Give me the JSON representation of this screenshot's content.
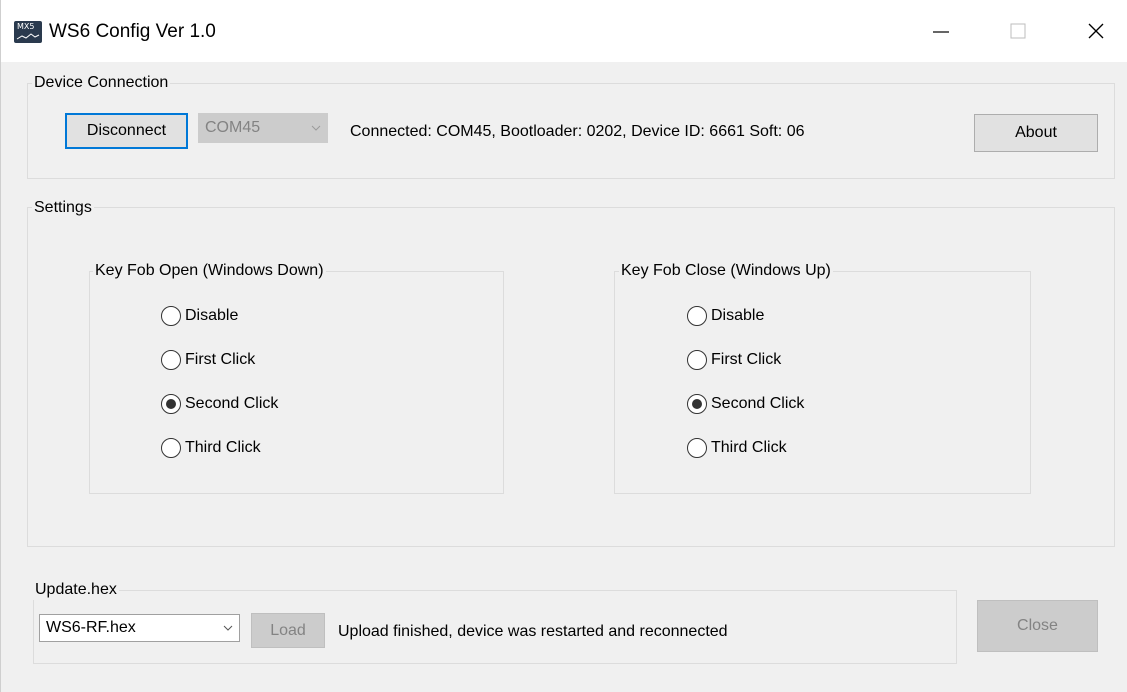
{
  "window": {
    "title": "WS6 Config Ver 1.0",
    "app_icon_text": "MX5"
  },
  "device_connection": {
    "label": "Device Connection",
    "disconnect_label": "Disconnect",
    "port_value": "COM45",
    "status": "Connected: COM45, Bootloader: 0202, Device ID: 6661 Soft: 06",
    "about_label": "About"
  },
  "settings": {
    "label": "Settings",
    "open_group": {
      "label": "Key Fob Open (Windows Down)",
      "options": [
        "Disable",
        "First Click",
        "Second Click",
        "Third Click"
      ],
      "selected": "Second Click"
    },
    "close_group": {
      "label": "Key Fob Close (Windows Up)",
      "options": [
        "Disable",
        "First Click",
        "Second Click",
        "Third Click"
      ],
      "selected": "Second Click"
    }
  },
  "update": {
    "label": "Update.hex",
    "file_value": "WS6-RF.hex",
    "load_label": "Load",
    "status": "Upload finished, device was restarted and reconnected",
    "close_label": "Close"
  }
}
